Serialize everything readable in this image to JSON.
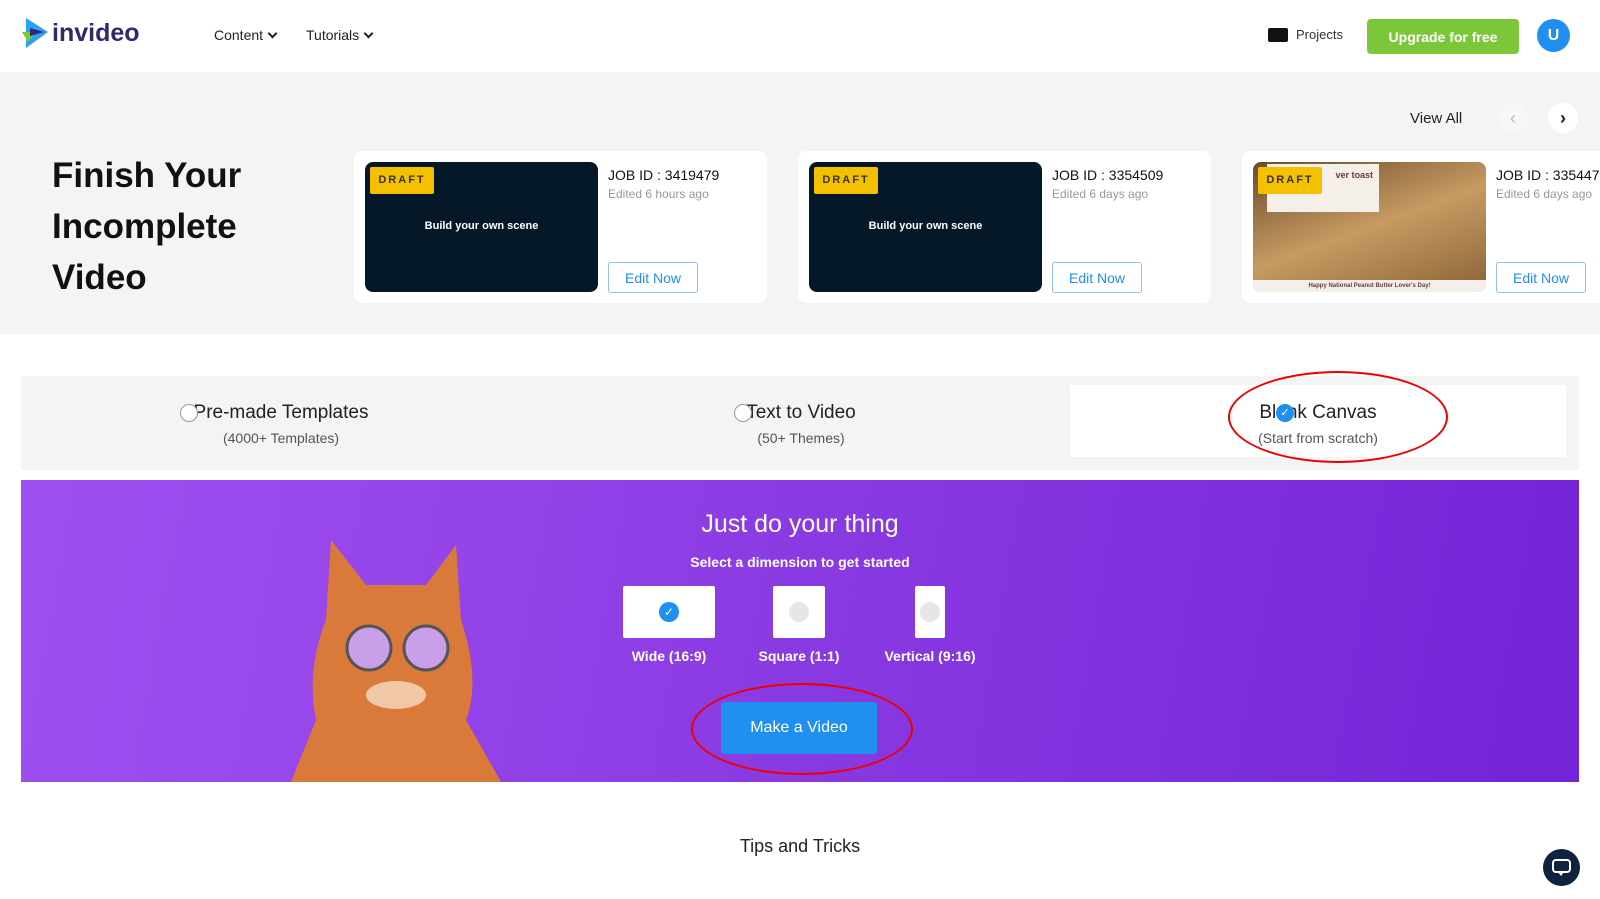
{
  "header": {
    "logo": "invideo",
    "nav": [
      "Content",
      "Tutorials"
    ],
    "projects": "Projects",
    "upgrade": "Upgrade for free",
    "avatar": "U"
  },
  "drafts": {
    "title_lines": [
      "Finish Your",
      "Incomplete",
      "Video"
    ],
    "view_all": "View All",
    "cards": [
      {
        "badge": "DRAFT",
        "scene": "Build your own scene",
        "job_id": "JOB ID : 3419479",
        "edited": "Edited 6 hours ago",
        "button": "Edit Now"
      },
      {
        "badge": "DRAFT",
        "scene": "Build your own scene",
        "job_id": "JOB ID : 3354509",
        "edited": "Edited 6 days ago",
        "button": "Edit Now"
      },
      {
        "badge": "DRAFT",
        "scene": "",
        "thumb_title": "ver toast",
        "thumb_caption": "Happy National Peanut Butter Lover's Day!",
        "job_id": "JOB ID : 335447",
        "edited": "Edited 6 days ago",
        "button": "Edit Now"
      }
    ]
  },
  "options": [
    {
      "title": "Pre-made Templates",
      "sub": "(4000+ Templates)",
      "selected": false
    },
    {
      "title": "Text to Video",
      "sub": "(50+ Themes)",
      "selected": false
    },
    {
      "title": "Blank Canvas",
      "sub": "(Start from scratch)",
      "selected": true
    }
  ],
  "canvas": {
    "title": "Just do your thing",
    "subtitle": "Select a dimension to get started",
    "dimensions": [
      {
        "label": "Wide (16:9)",
        "selected": true
      },
      {
        "label": "Square (1:1)",
        "selected": false
      },
      {
        "label": "Vertical (9:16)",
        "selected": false
      }
    ],
    "button": "Make a Video"
  },
  "tips": "Tips and Tricks",
  "colors": {
    "accent": "#1f8ff0",
    "upgrade": "#7cc63a",
    "draft": "#f5c000",
    "purple": "#8a3ae2",
    "highlight": "#e00000"
  }
}
